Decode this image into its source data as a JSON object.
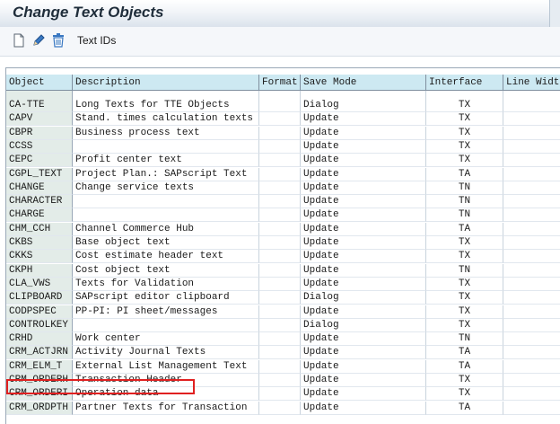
{
  "window": {
    "title": "Change Text Objects"
  },
  "toolbar": {
    "icons": [
      "new-document-icon",
      "edit-pencil-icon",
      "delete-trash-icon"
    ],
    "text_ids_label": "Text IDs"
  },
  "table": {
    "columns": [
      "Object",
      "Description",
      "Format",
      "Save Mode",
      "Interface",
      "Line Widt"
    ],
    "rows": [
      [
        "CA-TTE",
        "Long Texts for TTE Objects",
        "",
        "Dialog",
        "TX",
        ""
      ],
      [
        "CAPV",
        "Stand. times calculation texts",
        "",
        "Update",
        "TX",
        ""
      ],
      [
        "CBPR",
        "Business process text",
        "",
        "Update",
        "TX",
        ""
      ],
      [
        "CCSS",
        "",
        "",
        "Update",
        "TX",
        ""
      ],
      [
        "CEPC",
        "Profit center text",
        "",
        "Update",
        "TX",
        ""
      ],
      [
        "CGPL_TEXT",
        "Project Plan.: SAPscript Text",
        "",
        "Update",
        "TA",
        ""
      ],
      [
        "CHANGE",
        "Change service texts",
        "",
        "Update",
        "TN",
        ""
      ],
      [
        "CHARACTER",
        "",
        "",
        "Update",
        "TN",
        ""
      ],
      [
        "CHARGE",
        "",
        "",
        "Update",
        "TN",
        ""
      ],
      [
        "CHM_CCH",
        "Channel Commerce Hub",
        "",
        "Update",
        "TA",
        ""
      ],
      [
        "CKBS",
        "Base object text",
        "",
        "Update",
        "TX",
        ""
      ],
      [
        "CKKS",
        "Cost estimate header text",
        "",
        "Update",
        "TX",
        ""
      ],
      [
        "CKPH",
        "Cost object text",
        "",
        "Update",
        "TN",
        ""
      ],
      [
        "CLA_VWS",
        "Texts for Validation",
        "",
        "Update",
        "TX",
        ""
      ],
      [
        "CLIPBOARD",
        "SAPscript editor clipboard",
        "",
        "Dialog",
        "TX",
        ""
      ],
      [
        "CODPSPEC",
        "PP-PI: PI sheet/messages",
        "",
        "Update",
        "TX",
        ""
      ],
      [
        "CONTROLKEY",
        "",
        "",
        "Dialog",
        "TX",
        ""
      ],
      [
        "CRHD",
        "Work center",
        "",
        "Update",
        "TN",
        ""
      ],
      [
        "CRM_ACTJRN",
        "Activity Journal Texts",
        "",
        "Update",
        "TA",
        ""
      ],
      [
        "CRM_ELM_T",
        "External List Management Text",
        "",
        "Update",
        "TA",
        ""
      ],
      [
        "CRM_ORDERH",
        "Transaction Header",
        "",
        "Update",
        "TX",
        ""
      ],
      [
        "CRM_ORDERI",
        "Operation data",
        "",
        "Update",
        "TX",
        ""
      ],
      [
        "CRM_ORDPTH",
        "Partner Texts for Transaction",
        "",
        "Update",
        "TA",
        ""
      ]
    ],
    "highlighted_row": 20
  },
  "colors": {
    "header_bg": "#cde9f2",
    "key_col_bg": "#e3ece8",
    "highlight": "#e02020"
  }
}
